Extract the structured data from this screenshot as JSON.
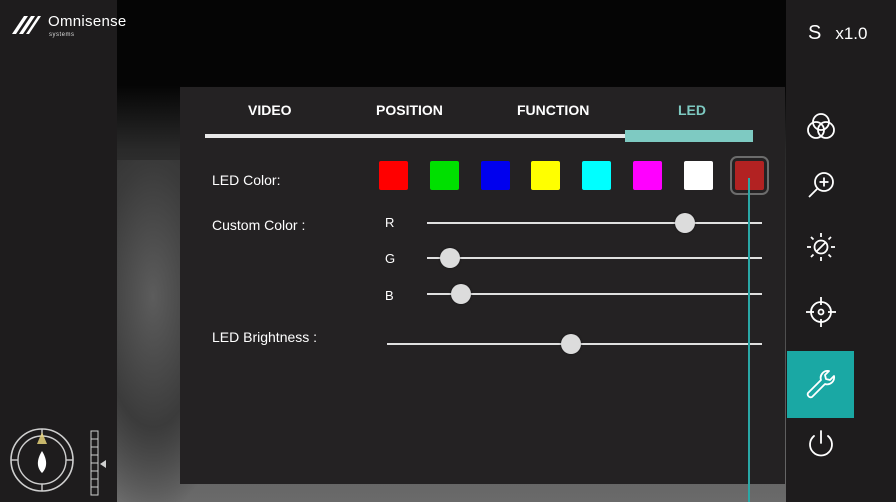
{
  "brand": {
    "name": "Omnisense",
    "sub": "systems"
  },
  "status": {
    "mode": "S",
    "zoom": "x1.0"
  },
  "tabs": [
    {
      "label": "VIDEO",
      "active": false
    },
    {
      "label": "POSITION",
      "active": false
    },
    {
      "label": "FUNCTION",
      "active": false
    },
    {
      "label": "LED",
      "active": true
    }
  ],
  "led": {
    "color_label": "LED Color:",
    "colors": [
      "#ff0000",
      "#00e000",
      "#0000ee",
      "#ffff00",
      "#00ffff",
      "#ff00ff",
      "#ffffff",
      "#b22222"
    ],
    "selected_color_index": 7,
    "custom_label": "Custom Color :",
    "channels": [
      {
        "label": "R",
        "level": 0.77
      },
      {
        "label": "G",
        "level": 0.07
      },
      {
        "label": "B",
        "level": 0.1
      }
    ],
    "brightness_label": "LED Brightness :",
    "brightness_level": 0.49
  },
  "sidebar": [
    {
      "name": "color-filter",
      "icon": "color-circles-icon",
      "active": false
    },
    {
      "name": "zoom-in",
      "icon": "zoom-in-icon",
      "active": false
    },
    {
      "name": "brightness",
      "icon": "brightness-icon",
      "active": false
    },
    {
      "name": "target",
      "icon": "crosshair-icon",
      "active": false
    },
    {
      "name": "settings",
      "icon": "wrench-icon",
      "active": true
    },
    {
      "name": "power",
      "icon": "power-icon",
      "active": false
    }
  ],
  "colors": {
    "accent": "#7ecac2",
    "active_button": "#1aa8a4",
    "panel": "#242223"
  }
}
